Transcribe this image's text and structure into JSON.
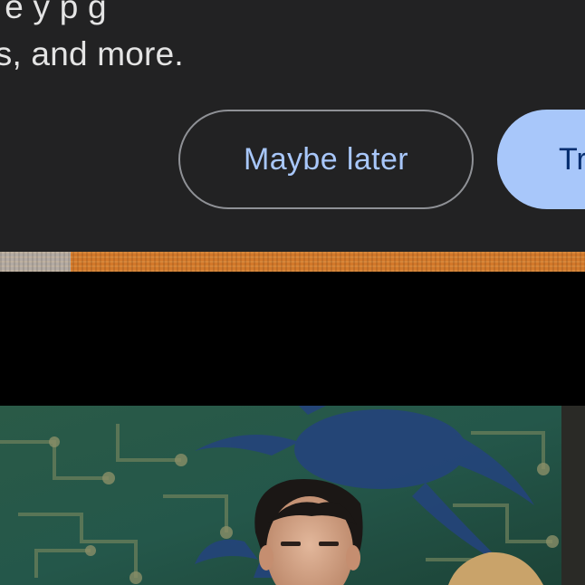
{
  "promo": {
    "text_line_1": "g   e   y p    g",
    "text_line_2": "es, and more.",
    "maybe_later_label": "Maybe later",
    "try_label": "Tr"
  },
  "photo": {
    "description_icon": "photo-thumbnail"
  },
  "colors": {
    "card_background": "#222223",
    "accent_text": "#a8c7fa",
    "primary_button": "#a8c7fa",
    "outline": "#8f9196"
  }
}
